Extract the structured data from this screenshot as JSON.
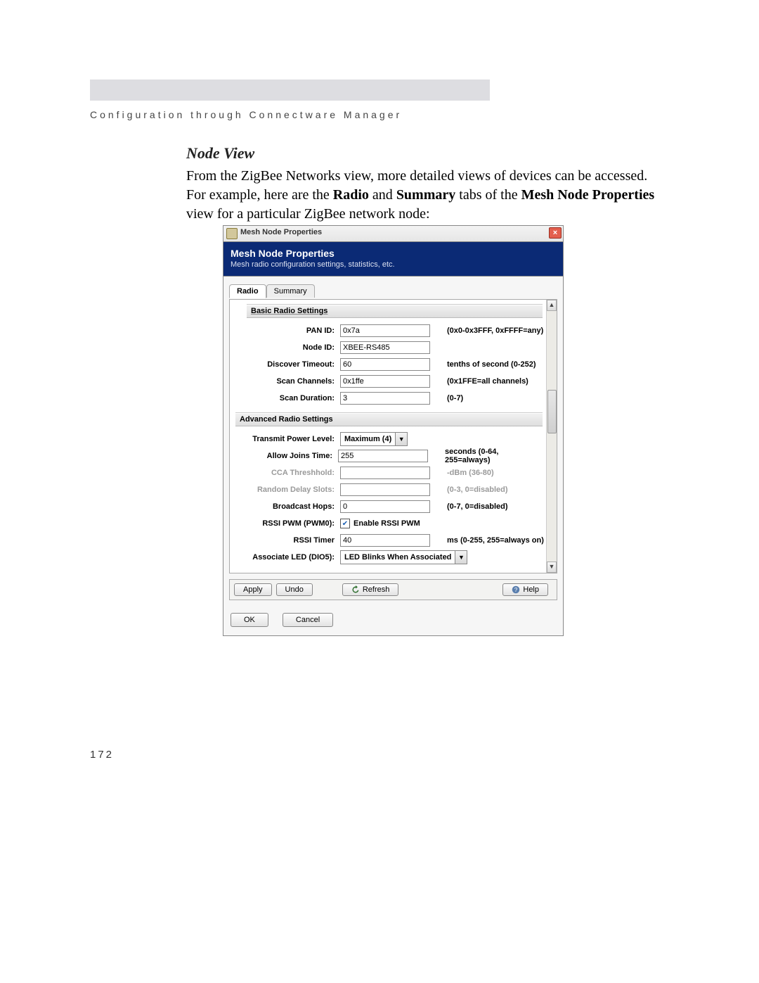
{
  "chapter_header": "Configuration through Connectware Manager",
  "node_view": {
    "heading": "Node View",
    "paragraph_parts": [
      "From the ZigBee Networks view, more detailed views of devices can be accessed. For example, here are the ",
      "Radio",
      " and ",
      "Summary",
      " tabs of the ",
      "Mesh Node Properties",
      " view for a particular ZigBee network node:"
    ]
  },
  "dialog": {
    "title": "Mesh Node Properties",
    "header_title": "Mesh Node Properties",
    "header_subtitle": "Mesh radio configuration settings, statistics, etc.",
    "tabs": {
      "radio": "Radio",
      "summary": "Summary"
    },
    "basic": {
      "section": "Basic Radio Settings",
      "pan_id": {
        "label": "PAN ID:",
        "value": "0x7a",
        "hint": "(0x0-0x3FFF, 0xFFFF=any)"
      },
      "node_id": {
        "label": "Node ID:",
        "value": "XBEE-RS485",
        "hint": ""
      },
      "discover": {
        "label": "Discover Timeout:",
        "value": "60",
        "hint": "tenths of second (0-252)"
      },
      "scan_ch": {
        "label": "Scan Channels:",
        "value": "0x1ffe",
        "hint": "(0x1FFE=all channels)"
      },
      "scan_dur": {
        "label": "Scan Duration:",
        "value": "3",
        "hint": "(0-7)"
      }
    },
    "advanced": {
      "section": "Advanced Radio Settings",
      "tx_power": {
        "label": "Transmit Power Level:",
        "value": "Maximum (4)",
        "hint": ""
      },
      "allow_joins": {
        "label": "Allow Joins Time:",
        "value": "255",
        "hint": "seconds (0-64, 255=always)"
      },
      "cca": {
        "label": "CCA Threshhold:",
        "value": "",
        "hint": "-dBm (36-80)"
      },
      "rand_delay": {
        "label": "Random Delay Slots:",
        "value": "",
        "hint": "(0-3, 0=disabled)"
      },
      "bcast_hops": {
        "label": "Broadcast Hops:",
        "value": "0",
        "hint": "(0-7, 0=disabled)"
      },
      "rssi_pwm": {
        "label": "RSSI PWM (PWM0):",
        "chk_label": "Enable RSSI PWM"
      },
      "rssi_timer": {
        "label": "RSSI Timer",
        "value": "40",
        "hint": "ms (0-255, 255=always on)"
      },
      "assoc_led": {
        "label": "Associate LED (DIO5):",
        "value": "LED Blinks When Associated"
      }
    },
    "buttons": {
      "apply": "Apply",
      "undo": "Undo",
      "refresh": "Refresh",
      "help": "Help",
      "ok": "OK",
      "cancel": "Cancel"
    }
  },
  "page_number": "172"
}
